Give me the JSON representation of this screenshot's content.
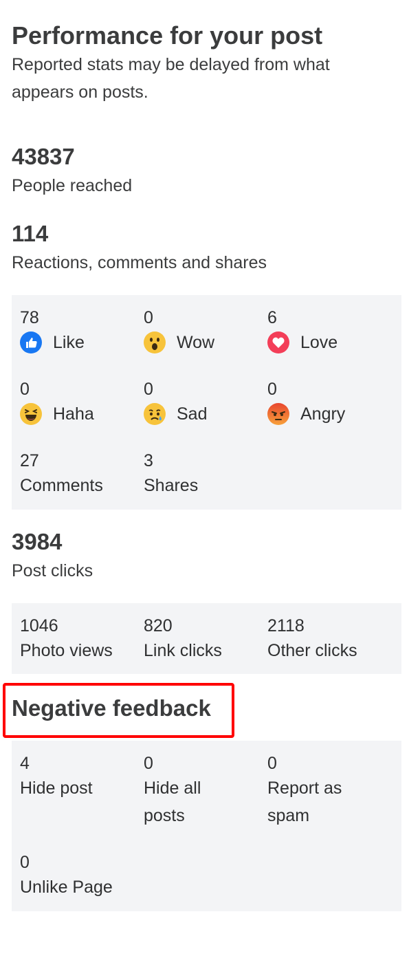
{
  "header": {
    "title": "Performance for your post",
    "subtitle": "Reported stats may be delayed from what appears on posts."
  },
  "reach": {
    "value": "43837",
    "label": "People reached"
  },
  "engagement": {
    "value": "114",
    "label": "Reactions, comments and shares"
  },
  "reactions": [
    {
      "count": "78",
      "label": "Like",
      "icon": "like-icon"
    },
    {
      "count": "0",
      "label": "Wow",
      "icon": "wow-icon"
    },
    {
      "count": "6",
      "label": "Love",
      "icon": "love-icon"
    },
    {
      "count": "0",
      "label": "Haha",
      "icon": "haha-icon"
    },
    {
      "count": "0",
      "label": "Sad",
      "icon": "sad-icon"
    },
    {
      "count": "0",
      "label": "Angry",
      "icon": "angry-icon"
    }
  ],
  "interactions": [
    {
      "count": "27",
      "label": "Comments"
    },
    {
      "count": "3",
      "label": "Shares"
    }
  ],
  "clicks": {
    "value": "3984",
    "label": "Post clicks",
    "items": [
      {
        "count": "1046",
        "label": "Photo views"
      },
      {
        "count": "820",
        "label": "Link clicks"
      },
      {
        "count": "2118",
        "label": "Other clicks"
      }
    ]
  },
  "negative": {
    "title": "Negative feedback",
    "items": [
      {
        "count": "4",
        "label": "Hide post"
      },
      {
        "count": "0",
        "label": "Hide all posts"
      },
      {
        "count": "0",
        "label": "Report as spam"
      },
      {
        "count": "0",
        "label": "Unlike Page"
      }
    ]
  },
  "colors": {
    "panel_bg": "#f3f4f6",
    "highlight_border": "#ff0000",
    "like_blue": "#1877f2",
    "love_red": "#f33e58"
  }
}
